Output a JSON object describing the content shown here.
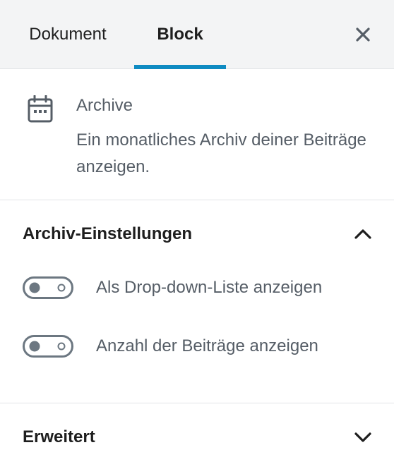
{
  "tabs": {
    "document_label": "Dokument",
    "block_label": "Block",
    "active": "block"
  },
  "close_icon": "close-icon",
  "block_card": {
    "icon": "calendar-icon",
    "title": "Archive",
    "description": "Ein monatliches Archiv deiner Beiträge anzeigen."
  },
  "settings_panel": {
    "title": "Archiv-Einstellungen",
    "expanded": true,
    "toggles": [
      {
        "label": "Als Drop-down-Liste anzeigen",
        "checked": false
      },
      {
        "label": "Anzahl der Beiträge anzeigen",
        "checked": false
      }
    ]
  },
  "advanced_panel": {
    "title": "Erweitert",
    "expanded": false
  },
  "colors": {
    "accent": "#0e8bc2",
    "text": "#1e1e1e",
    "muted": "#555d66",
    "header_bg": "#f3f4f5",
    "border": "#e2e4e7"
  }
}
